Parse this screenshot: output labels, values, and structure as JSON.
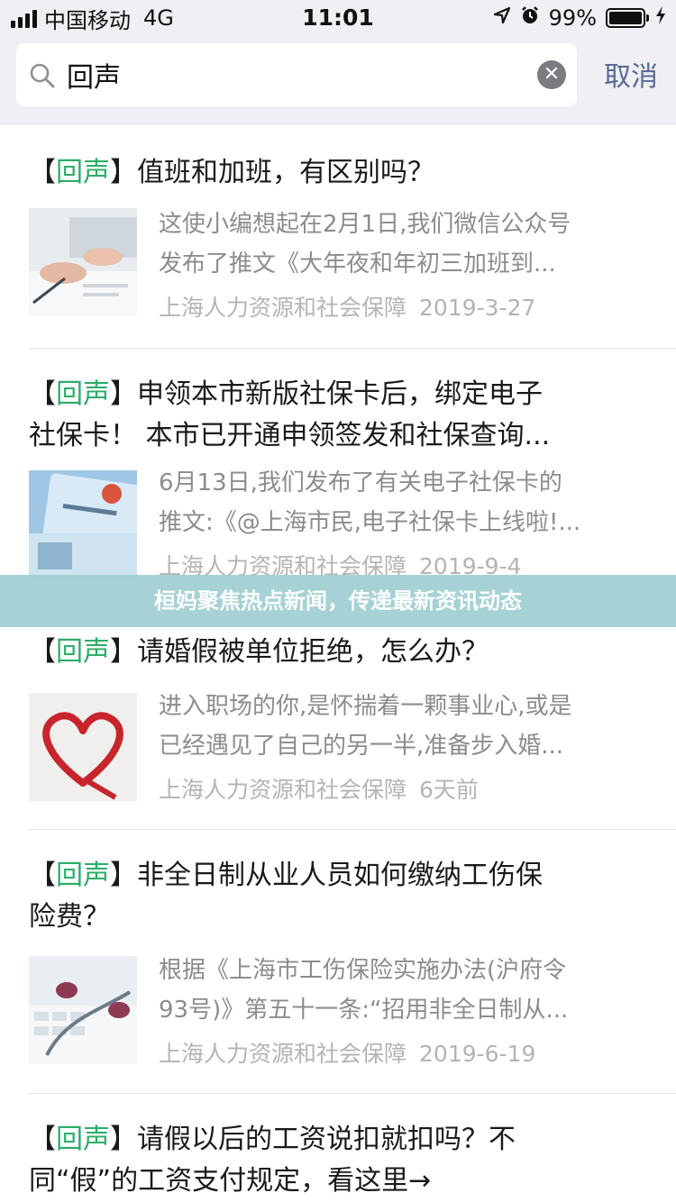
{
  "status_bar": {
    "carrier": "中国移动",
    "network": "4G",
    "time": "11:01",
    "battery": "99%",
    "battery_level": 0.99,
    "icons": [
      "signal-icon",
      "location-arrow-icon",
      "alarm-icon",
      "battery-icon",
      "charging-icon"
    ]
  },
  "search": {
    "query": "回声",
    "cancel_label": "取消"
  },
  "banner": {
    "text": "桓妈聚焦热点新闻，传递最新资讯动态"
  },
  "results": [
    {
      "tag_open": "【",
      "keyword": "回声",
      "tag_close": "】",
      "title_line1": "值班和加班，有区别吗？",
      "title_line2": "",
      "summary_line1": "这使小编想起在2月1日,我们微信公众号",
      "summary_line2": "发布了推文《大年夜和年初三加班到...",
      "source": "上海人力资源和社会保障",
      "date": "2019-3-27"
    },
    {
      "tag_open": "【",
      "keyword": "回声",
      "tag_close": "】",
      "title_line1": "申领本市新版社保卡后，绑定电子",
      "title_line2": "社保卡！ 本市已开通申领签发和社保查询...",
      "summary_line1": "6月13日,我们发布了有关电子社保卡的",
      "summary_line2": "推文:《@上海市民,电子社保卡上线啦!...",
      "source": "上海人力资源和社会保障",
      "date": "2019-9-4"
    },
    {
      "tag_open": "【",
      "keyword": "回声",
      "tag_close": "】",
      "title_line1": "请婚假被单位拒绝，怎么办？",
      "title_line2": "",
      "summary_line1": "进入职场的你,是怀揣着一颗事业心,或是",
      "summary_line2": "已经遇见了自己的另一半,准备步入婚...",
      "source": "上海人力资源和社会保障",
      "date": "6天前"
    },
    {
      "tag_open": "【",
      "keyword": "回声",
      "tag_close": "】",
      "title_line1": "非全日制从业人员如何缴纳工伤保",
      "title_line2": "险费？",
      "summary_line1": "根据《上海市工伤保险实施办法(沪府令",
      "summary_line2": "93号)》第五十一条:“招用非全日制从...",
      "source": "上海人力资源和社会保障",
      "date": "2019-6-19"
    },
    {
      "tag_open": "【",
      "keyword": "回声",
      "tag_close": "】",
      "title_line1": "请假以后的工资说扣就扣吗？不",
      "title_line2": "同“假”的工资支付规定，看这里→",
      "summary_line1": "",
      "summary_line2": "",
      "source": "",
      "date": ""
    }
  ]
}
